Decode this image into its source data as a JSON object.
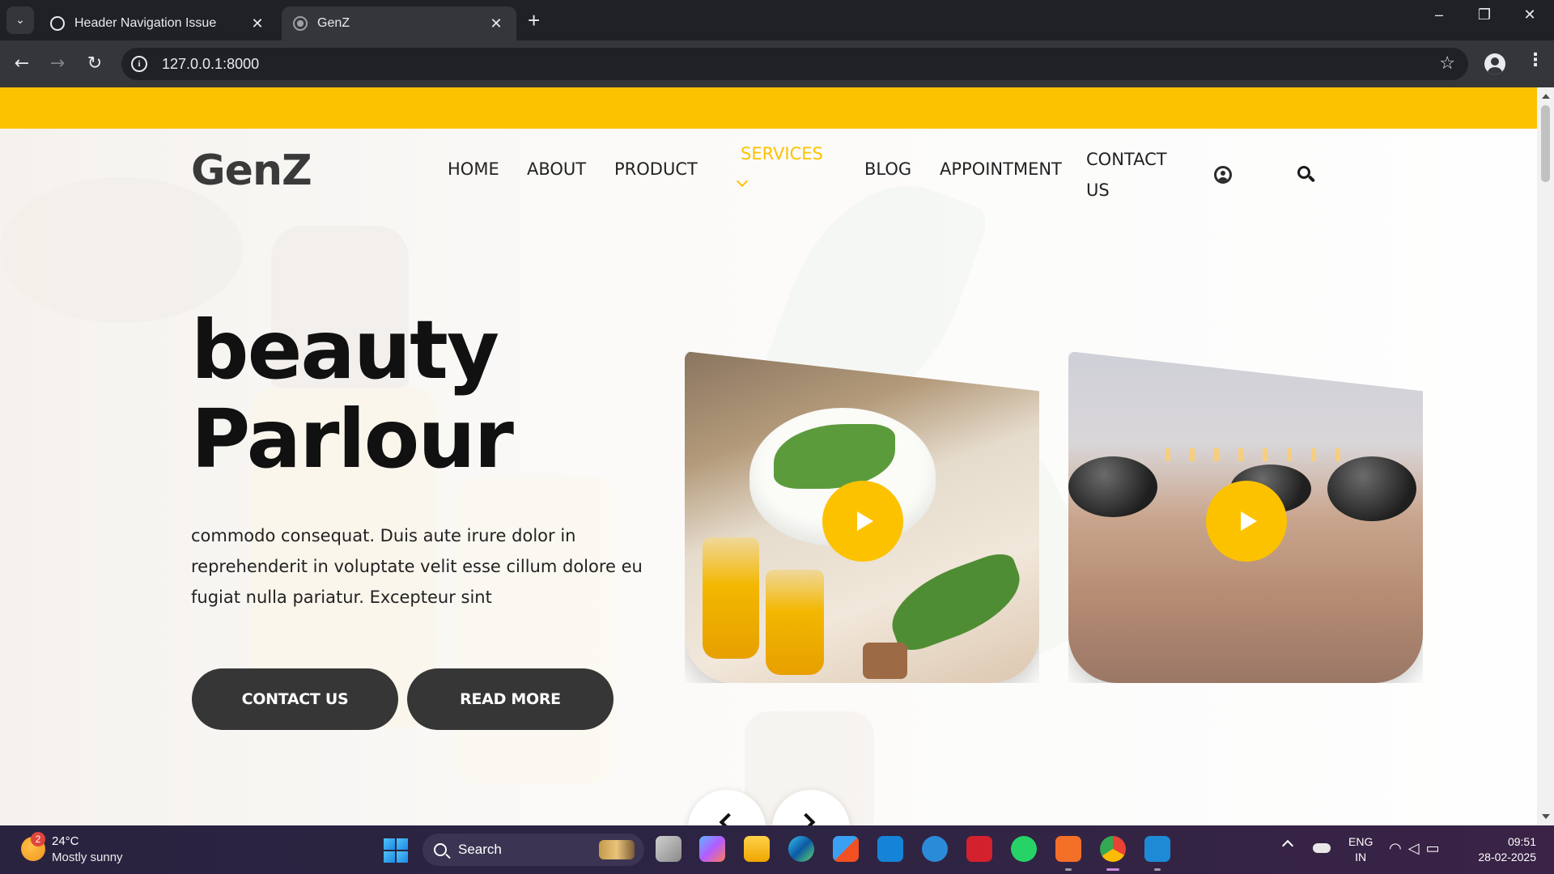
{
  "browser": {
    "tabs": [
      {
        "title": "Header Navigation Issue",
        "active": false
      },
      {
        "title": "GenZ",
        "active": true
      }
    ],
    "new_tab_symbol": "+",
    "url": "127.0.0.1:8000",
    "window_controls": {
      "minimize": "–",
      "restore": "❐",
      "close": "✕"
    }
  },
  "site": {
    "logo": "GenZ",
    "accent_color": "#fcc200",
    "nav": [
      {
        "label": "HOME",
        "active": false
      },
      {
        "label": "ABOUT",
        "active": false
      },
      {
        "label": "PRODUCT",
        "active": false
      },
      {
        "label": "SERVICES",
        "active": true
      },
      {
        "label": "BLOG",
        "active": false
      },
      {
        "label": "APPOINTMENT",
        "active": false
      },
      {
        "label": "CONTACT US",
        "active": false
      }
    ],
    "nav_contact_line1": "CONTACT",
    "nav_contact_line2": "US",
    "header_icons": [
      "user-circle-icon",
      "search-icon"
    ]
  },
  "hero": {
    "title_line1": "beauty",
    "title_line2": "Parlour",
    "text": "commodo consequat. Duis aute irure dolor in reprehenderit in voluptate velit esse cillum dolore eu fugiat nulla pariatur. Excepteur sint",
    "buttons": {
      "contact": "CONTACT US",
      "read_more": "READ MORE"
    },
    "video_cards": [
      "spa-oils-video",
      "hot-stone-massage-video"
    ]
  },
  "taskbar": {
    "weather": {
      "temp": "24°C",
      "desc": "Mostly sunny",
      "badge": "2"
    },
    "search_label": "Search",
    "apps": [
      "task-view",
      "copilot",
      "file-explorer",
      "edge",
      "store",
      "myhp",
      "help",
      "mcafee",
      "whatsapp",
      "xampp",
      "chrome",
      "vscode"
    ],
    "lang_line1": "ENG",
    "lang_line2": "IN",
    "time": "09:51",
    "date": "28-02-2025"
  }
}
